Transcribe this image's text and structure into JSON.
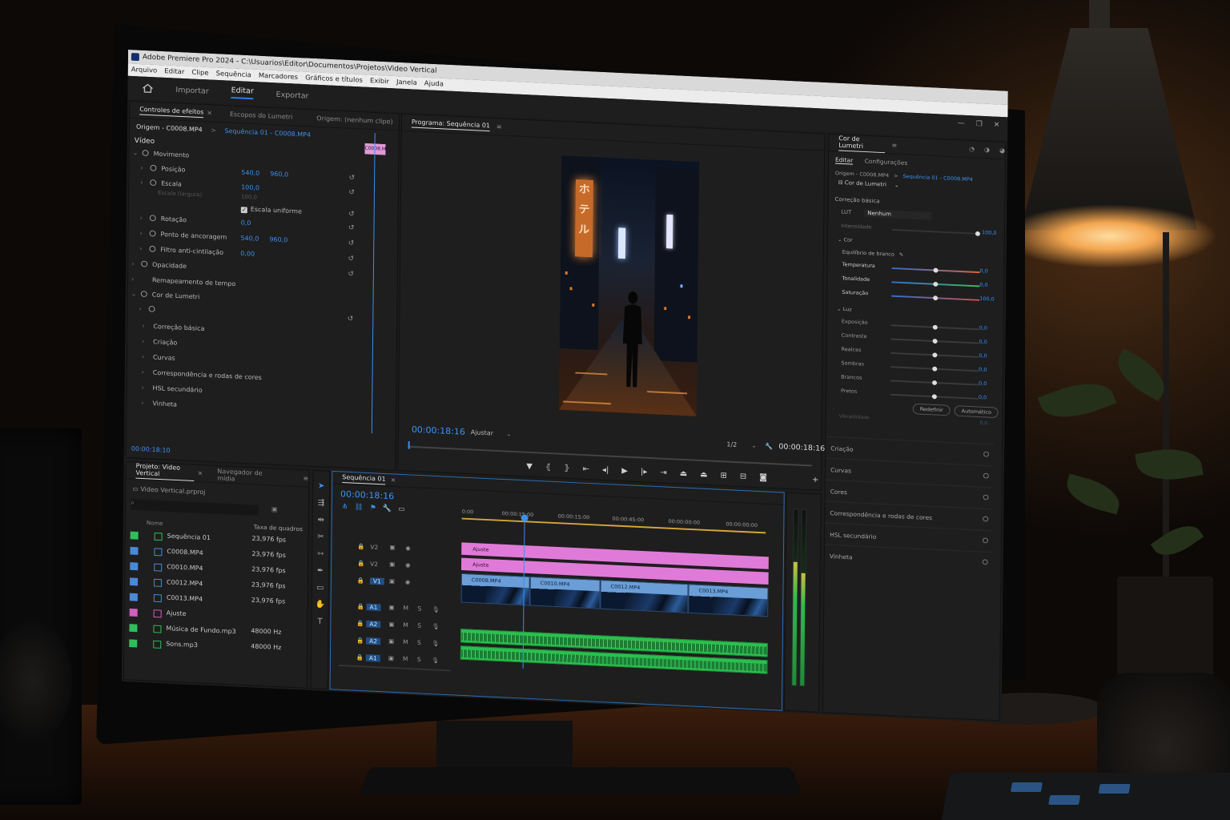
{
  "window": {
    "title": "Adobe Premiere Pro 2024 - C:\\Usuarios\\Editor\\Documentos\\Projetos\\Video Vertical",
    "menu": [
      "Arquivo",
      "Editar",
      "Clipe",
      "Sequência",
      "Marcadores",
      "Gráficos e títulos",
      "Exibir",
      "Janela",
      "Ajuda"
    ],
    "workspaces": [
      "Importar",
      "Editar",
      "Exportar"
    ],
    "active_workspace": "Editar"
  },
  "effects_panel": {
    "tabs": [
      "Controles de efeitos",
      "Escopos do Lumetri",
      "Origem: (nenhum clipe)"
    ],
    "source_label": "Origem - C0008.MP4",
    "sequence_label": "Sequência 01 - C0008.MP4",
    "mini_clip_label": "C0008.MP4",
    "section_video": "Vídeo",
    "motion": "Movimento",
    "position": {
      "label": "Posição",
      "x": "540,0",
      "y": "960,0"
    },
    "scale": {
      "label": "Escala",
      "value": "100,0"
    },
    "scale_width": "Escala (largura)",
    "scale_width_value": "100,0",
    "uniform_scale": "Escala uniforme",
    "rotation": {
      "label": "Rotação",
      "value": "0,0"
    },
    "anchor": {
      "label": "Ponto de ancoragem",
      "x": "540,0",
      "y": "960,0"
    },
    "antiflicker": {
      "label": "Filtro anti-cintilação",
      "value": "0,00"
    },
    "opacity": "Opacidade",
    "time_remap": "Remapeamento de tempo",
    "lumetri": "Cor de Lumetri",
    "lumetri_items": [
      "Correção básica",
      "Criação",
      "Curvas",
      "Correspondência e rodas de cores",
      "HSL secundário",
      "Vinheta"
    ],
    "timecode": "00:00:18:10"
  },
  "program_monitor": {
    "title": "Programa: Sequência 01",
    "timecode_left": "00:00:18:16",
    "fit": "Ajustar",
    "resolution": "1/2",
    "timecode_right": "00:00:18:16",
    "sign_text": "ホテル"
  },
  "lumetri_panel": {
    "title": "Cor de Lumetri",
    "tabs": [
      "Editar",
      "Configurações"
    ],
    "source": "Origem - C0008.MP4",
    "sequence": "Sequência 01 - C0008.MP4",
    "effect_name": "Cor de Lumetri",
    "basic": "Correção básica",
    "lut_label": "LUT",
    "lut_value": "Nenhum",
    "intensity_label": "Intensidade",
    "intensity_value": "100,0",
    "color_group": "Cor",
    "white_balance": "Equilíbrio de branco",
    "color_sliders": [
      {
        "label": "Temperatura",
        "value": "0,0",
        "level": 0.5,
        "color": "#e06040"
      },
      {
        "label": "Tonalidade",
        "value": "0,0",
        "level": 0.5,
        "color": "#3cc060"
      },
      {
        "label": "Saturação",
        "value": "100,0",
        "level": 0.5,
        "color": "#d14f4f"
      }
    ],
    "light_group": "Luz",
    "light_sliders": [
      {
        "label": "Exposição",
        "value": "0,0",
        "level": 0.5
      },
      {
        "label": "Contraste",
        "value": "0,0",
        "level": 0.5
      },
      {
        "label": "Realces",
        "value": "0,0",
        "level": 0.5
      },
      {
        "label": "Sombras",
        "value": "0,0",
        "level": 0.5
      },
      {
        "label": "Brancos",
        "value": "0,0",
        "level": 0.5
      },
      {
        "label": "Pretos",
        "value": "0,0",
        "level": 0.5
      }
    ],
    "reset": "Redefinir",
    "auto": "Automático",
    "vibrance_label": "Vibratilidade",
    "vibrance_value": "0,0",
    "sections": [
      "Criação",
      "Curvas",
      "Cores",
      "Correspondência e rodas de cores",
      "HSL secundário",
      "Vinheta"
    ]
  },
  "project_panel": {
    "tabs": [
      "Projeto: Video Vertical",
      "Navegador de mídia"
    ],
    "file": "Video Vertical.prproj",
    "col_name": "Nome",
    "col_rate": "Taxa de quadros",
    "items": [
      {
        "name": "Sequência 01",
        "rate": "23,976 fps",
        "color": "#2fbf5b"
      },
      {
        "name": "C0008.MP4",
        "rate": "23,976 fps",
        "color": "#4a89d6"
      },
      {
        "name": "C0010.MP4",
        "rate": "23,976 fps",
        "color": "#4a89d6"
      },
      {
        "name": "C0012.MP4",
        "rate": "23,976 fps",
        "color": "#4a89d6"
      },
      {
        "name": "C0013.MP4",
        "rate": "23,976 fps",
        "color": "#4a89d6"
      },
      {
        "name": "Ajuste",
        "rate": "",
        "color": "#d15fbd"
      },
      {
        "name": "Música de Fundo.mp3",
        "rate": "48000 Hz",
        "color": "#2fbf5b"
      },
      {
        "name": "Sons.mp3",
        "rate": "48000 Hz",
        "color": "#2fbf5b"
      }
    ]
  },
  "timeline": {
    "title": "Sequência 01",
    "timecode": "00:00:18:16",
    "ruler": [
      "0:00",
      "00:00:15:00",
      "00:00:15:00",
      "00:00:45:00",
      "00:00:00:00",
      "00:00:00:00"
    ],
    "video_tracks": [
      "V2",
      "V2",
      "V1"
    ],
    "audio_tracks": [
      "A1",
      "A2",
      "A2",
      "A1"
    ],
    "adjust_label": "Ajuste",
    "v1_clips": [
      "C0008.MP4",
      "C0010.MP4",
      "C0012.MP4",
      "C0013.MP4"
    ],
    "colors": {
      "adjustment": "#e07ad8",
      "video": "#6b9ed7",
      "audio": "#2bc04e",
      "playhead": "#3b8ff0"
    }
  }
}
